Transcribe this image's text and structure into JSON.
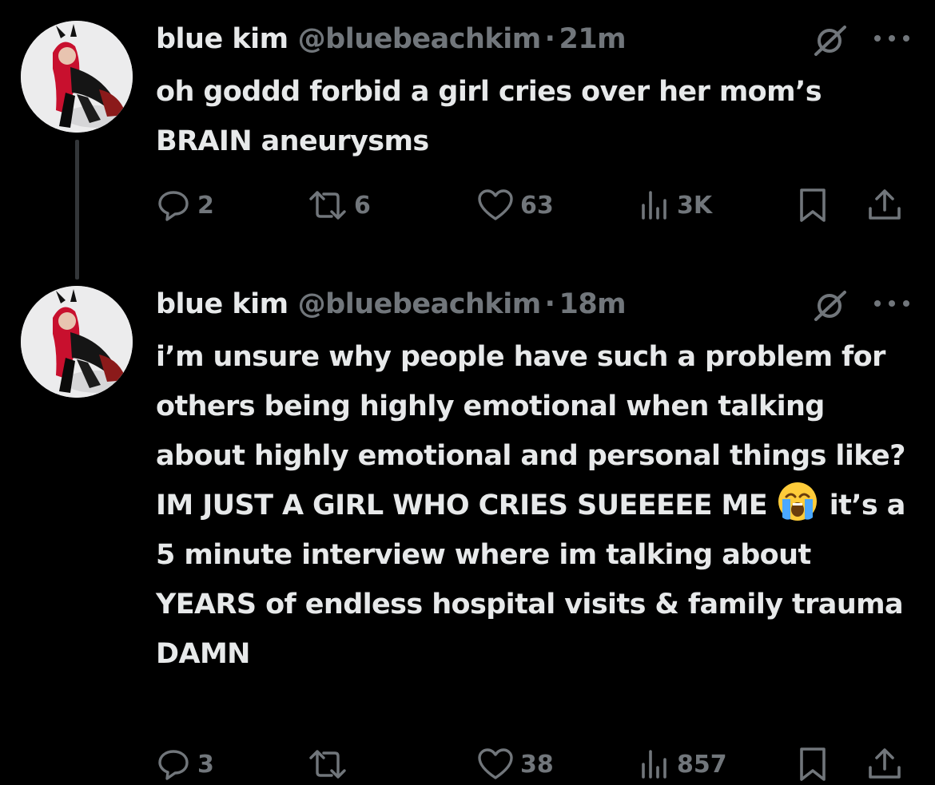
{
  "thread": [
    {
      "author": {
        "name": "blue kim",
        "handle": "@bluebeachkim"
      },
      "separator": "·",
      "time": "21m",
      "text": "oh goddd forbid a girl cries over her mom’s BRAIN aneurysms",
      "emoji": "",
      "text_after_emoji": "",
      "metrics": {
        "replies": "2",
        "reposts": "6",
        "likes": "63",
        "views": "3K"
      }
    },
    {
      "author": {
        "name": "blue kim",
        "handle": "@bluebeachkim"
      },
      "separator": "·",
      "time": "18m",
      "text": "i’m unsure why people have such a problem for others being highly emotional when talking about highly emotional and personal things like? IM JUST A GIRL WHO CRIES SUEEEEE ME",
      "emoji": "loudly-crying-face",
      "text_after_emoji": "it’s a 5 minute interview where im talking about YEARS of endless hospital visits & family trauma DAMN",
      "metrics": {
        "replies": "3",
        "reposts": "",
        "likes": "38",
        "views": "857"
      }
    }
  ],
  "icons": {
    "reply": "speech-bubble-icon",
    "repost": "repost-arrows-icon",
    "like": "heart-icon",
    "views": "bar-chart-icon",
    "bookmark": "bookmark-icon",
    "share": "share-upload-icon",
    "grok": "grok-slash-icon",
    "more": "more-dots-icon"
  },
  "colors": {
    "background": "#000000",
    "text": "#e7e9ea",
    "secondary": "#71767b",
    "thread_line": "#333639"
  }
}
